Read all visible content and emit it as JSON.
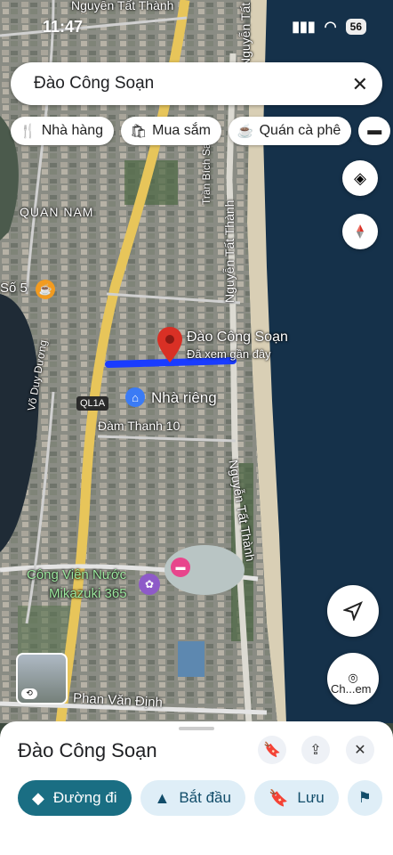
{
  "status_bar": {
    "time": "11:47",
    "battery": "56"
  },
  "search": {
    "query": "Đào Công Soạn"
  },
  "chips": [
    {
      "icon": "fork-knife-icon",
      "label": "Nhà hàng"
    },
    {
      "icon": "shopping-bag-icon",
      "label": "Mua sắm"
    },
    {
      "icon": "coffee-cup-icon",
      "label": "Quán cà phê"
    }
  ],
  "map_labels": {
    "street_top": "Nguyễn Tất Thành",
    "district": "QUAN NAM",
    "tran_bich_san": "Trần Bích San",
    "nguyen_tat_thanh_1": "Nguyễn Tất Thành",
    "nguyen_tat_thanh_2": "Nguyễn Tất Thành",
    "so5": "Số 5",
    "vo_duy_duong": "Võ Duy Dương",
    "pin_title": "Đào Công Soạn",
    "pin_subtitle": "Đã xem gần đây",
    "home": "Nhà riêng",
    "ql1a": "QL1A",
    "dam_thanh": "Đàm Thanh 10",
    "water_park_1": "Công Viên Nước",
    "water_park_2": "Mikazuki 365",
    "phan_van_dinh": "Phan Văn Định",
    "lens_label": "Ch...em"
  },
  "place_sheet": {
    "title": "Đào Công Soạn"
  },
  "actions": [
    {
      "icon": "directions-icon",
      "label": "Đường đi",
      "primary": true
    },
    {
      "icon": "navigate-arrow-icon",
      "label": "Bắt đầu",
      "primary": false
    },
    {
      "icon": "bookmark-icon",
      "label": "Lưu",
      "primary": false
    }
  ],
  "colors": {
    "pin": "#d93025",
    "route": "#1a3cff",
    "primary": "#1a6e83"
  }
}
